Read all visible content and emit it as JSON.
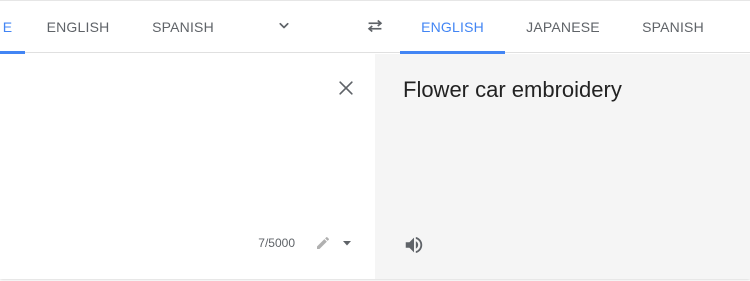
{
  "source_languages": {
    "active_fragment": "E",
    "tabs": [
      {
        "label": "ENGLISH"
      },
      {
        "label": "SPANISH"
      }
    ],
    "more_icon": "chevron-down-icon"
  },
  "swap_icon": "swap-arrows-icon",
  "target_languages": {
    "tabs": [
      {
        "label": "ENGLISH",
        "active": true
      },
      {
        "label": "JAPANESE"
      },
      {
        "label": "SPANISH"
      }
    ]
  },
  "source": {
    "clear_icon": "close-icon",
    "char_count": "7/5000",
    "edit_icon": "pencil-icon"
  },
  "target": {
    "translation": "Flower car embroidery",
    "speak_icon": "speaker-icon"
  },
  "colors": {
    "accent": "#4285f4",
    "tab_text": "#5f6368",
    "target_bg": "#f5f5f5"
  }
}
